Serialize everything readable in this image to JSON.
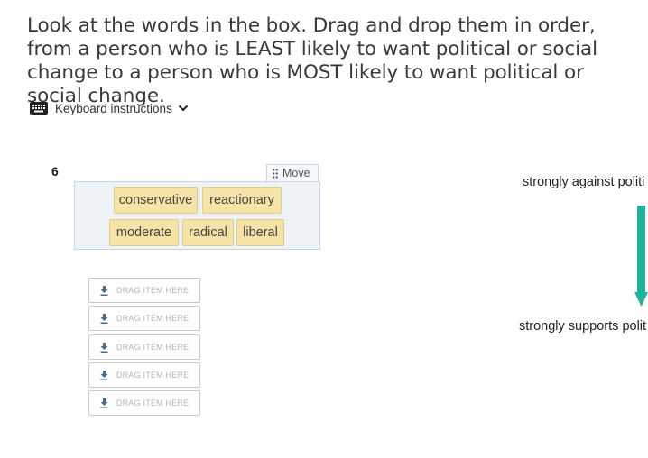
{
  "question": {
    "text": "Look at the words in the box. Drag and drop them in order, from a person who is LEAST likely to want political or social change to a person who is MOST likely to want political or social change."
  },
  "keyboard": {
    "label": "Keyboard instructions",
    "icon": "keyboard-icon",
    "toggle_icon": "chevron-down-icon"
  },
  "item": {
    "number": "6",
    "move_label": "Move",
    "tiles": [
      "conservative",
      "reactionary",
      "moderate",
      "radical",
      "liberal"
    ]
  },
  "drop_zones": [
    {
      "label": "DRAG ITEM HERE",
      "icon": "download-arrow-icon"
    },
    {
      "label": "DRAG ITEM HERE",
      "icon": "download-arrow-icon"
    },
    {
      "label": "DRAG ITEM HERE",
      "icon": "download-arrow-icon"
    },
    {
      "label": "DRAG ITEM HERE",
      "icon": "download-arrow-icon"
    },
    {
      "label": "DRAG ITEM HERE",
      "icon": "download-arrow-icon"
    }
  ],
  "scale": {
    "top_label": "strongly against politi",
    "bottom_label": "strongly supports polit",
    "arrow_color": "#1fb39b"
  },
  "colors": {
    "tile_bg": "#f6e3a6",
    "bank_bg": "#edf3f7"
  }
}
